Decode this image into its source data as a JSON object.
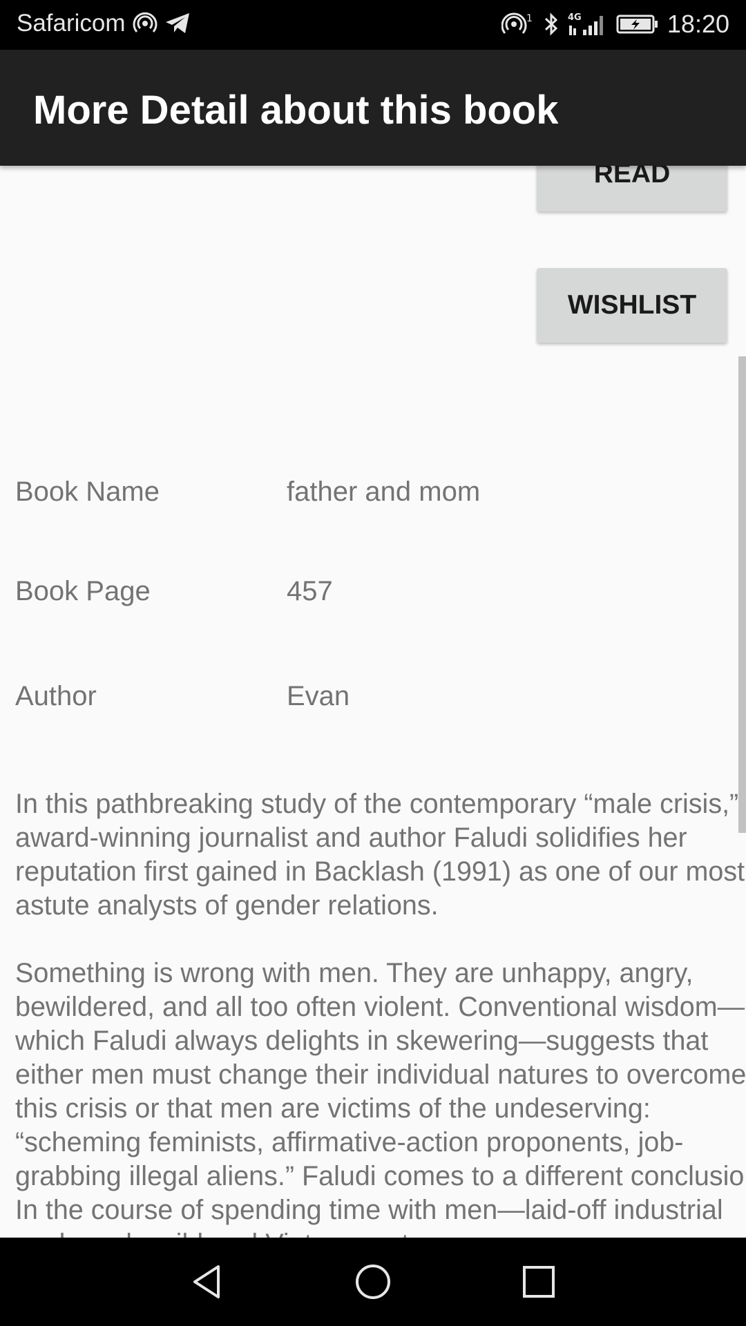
{
  "status_bar": {
    "carrier": "Safaricom",
    "network_label": "4G",
    "sim_index": "1",
    "time": "18:20"
  },
  "app_bar": {
    "title": "More Detail about this book"
  },
  "actions": {
    "read_label": "READ",
    "wishlist_label": "WISHLIST"
  },
  "book": {
    "fields": [
      {
        "label": "Book Name",
        "value": "father and mom"
      },
      {
        "label": "Book Page",
        "value": "457"
      },
      {
        "label": "Author",
        "value": "Evan"
      }
    ],
    "description_paragraphs": [
      "In this pathbreaking study of the contemporary “male crisis,” award-winning journalist and author Faludi solidifies her reputation first gained in Backlash (1991) as one of our most astute analysts of gender relations.",
      "Something is wrong with men. They are unhappy, angry, bewildered, and all too often violent. Conventional wisdom—which Faludi always delights in skewering—suggests that either men must change their individual natures to overcome this crisis or that men are victims of the undeserving: “scheming feminists, affirmative-action proponents, job-grabbing illegal aliens.” Faludi comes to a different conclusion. In the course of spending time with men—laid-off industrial workers, bewildered Vietnam veter"
    ]
  },
  "colors": {
    "app_bar": "#212121",
    "status_bar": "#000000",
    "background": "#fafafa",
    "button": "#d6d7d7",
    "text_secondary": "#737373"
  }
}
